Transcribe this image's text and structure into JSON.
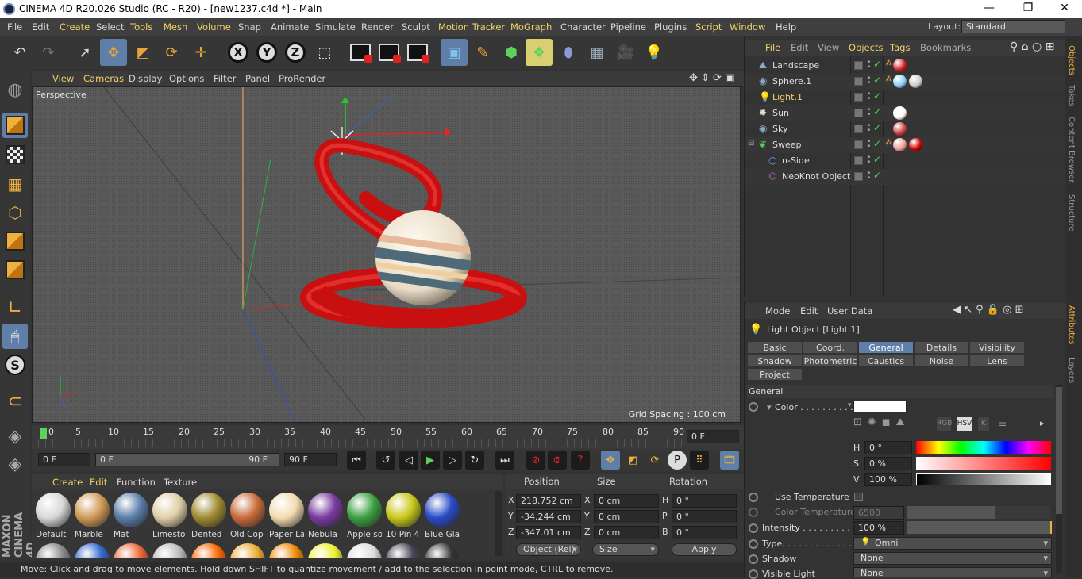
{
  "window": {
    "title": "CINEMA 4D R20.026 Studio (RC - R20) - [new1237.c4d *] - Main",
    "buttons": [
      "—",
      "❐",
      "✕"
    ]
  },
  "menubar": {
    "items": [
      "File",
      "Edit",
      "Create",
      "Select",
      "Tools",
      "Mesh",
      "Volume",
      "Snap",
      "Animate",
      "Simulate",
      "Render",
      "Sculpt",
      "Motion Tracker",
      "MoGraph",
      "Character",
      "Pipeline",
      "Plugins",
      "Script",
      "Window",
      "Help"
    ],
    "highlighted": [
      "Create",
      "Tools",
      "Mesh",
      "Volume",
      "Motion Tracker",
      "MoGraph",
      "Script",
      "Window"
    ],
    "layout_label": "Layout:",
    "layout_value": "Standard"
  },
  "viewport": {
    "menu": [
      "View",
      "Cameras",
      "Display",
      "Options",
      "Filter",
      "Panel",
      "ProRender"
    ],
    "label": "Perspective",
    "grid_spacing": "Grid Spacing : 100 cm"
  },
  "timeline": {
    "ticks": [
      "0",
      "5",
      "10",
      "15",
      "20",
      "25",
      "30",
      "35",
      "40",
      "45",
      "50",
      "55",
      "60",
      "65",
      "70",
      "75",
      "80",
      "85",
      "90"
    ],
    "frame": "0 F"
  },
  "transport": {
    "start": "0 F",
    "range_start": "0 F",
    "range_end": "90 F",
    "end": "90 F"
  },
  "materials": {
    "menu": [
      "Create",
      "Edit",
      "Function",
      "Texture"
    ],
    "items": [
      {
        "name": "Default",
        "color": "#d8d8d8"
      },
      {
        "name": "Marble",
        "color": "#d09a58"
      },
      {
        "name": "Mat",
        "color": "#5a7ea8"
      },
      {
        "name": "Limesto",
        "color": "#e0d0a8"
      },
      {
        "name": "Dented",
        "color": "#a08a30"
      },
      {
        "name": "Old Cop",
        "color": "#c86a38"
      },
      {
        "name": "Paper La",
        "color": "#f2dcb0"
      },
      {
        "name": "Nebula",
        "color": "#7a3aa0"
      },
      {
        "name": "Apple so",
        "color": "#3aa040"
      },
      {
        "name": "10 Pin 4",
        "color": "#c8c81a"
      },
      {
        "name": "Blue Gla",
        "color": "#2a4ac8"
      }
    ]
  },
  "coords": {
    "headers": [
      "Position",
      "Size",
      "Rotation"
    ],
    "rows": [
      {
        "axis": "X",
        "pos": "218.752 cm",
        "size_axis": "X",
        "size": "0 cm",
        "rot_axis": "H",
        "rot": "0 °"
      },
      {
        "axis": "Y",
        "pos": "-34.244 cm",
        "size_axis": "Y",
        "size": "0 cm",
        "rot_axis": "P",
        "rot": "0 °"
      },
      {
        "axis": "Z",
        "pos": "-347.01 cm",
        "size_axis": "Z",
        "size": "0 cm",
        "rot_axis": "B",
        "rot": "0 °"
      }
    ],
    "mode": "Object (Rel)",
    "size_mode": "Size",
    "apply": "Apply"
  },
  "status": "Move: Click and drag to move elements. Hold down SHIFT to quantize movement / add to the selection in point mode, CTRL to remove.",
  "objects": {
    "menu": [
      "File",
      "Edit",
      "View",
      "Objects",
      "Tags",
      "Bookmarks"
    ],
    "menu_highlight": [
      "File",
      "Objects",
      "Tags"
    ],
    "items": [
      {
        "name": "Landscape",
        "active": false
      },
      {
        "name": "Sphere.1",
        "active": false
      },
      {
        "name": "Light.1",
        "active": true
      },
      {
        "name": "Sun",
        "active": false
      },
      {
        "name": "Sky",
        "active": false
      },
      {
        "name": "Sweep",
        "active": false
      },
      {
        "name": "n-Side",
        "active": false
      },
      {
        "name": "NeoKnot Object",
        "active": false
      }
    ]
  },
  "right_tabs": [
    "Objects",
    "Takes",
    "Content Browser",
    "Structure",
    "Attributes",
    "Layers"
  ],
  "attributes": {
    "menu": [
      "Mode",
      "Edit",
      "User Data"
    ],
    "object_title": "Light Object [Light.1]",
    "tabs_row1": [
      "Basic",
      "Coord.",
      "General",
      "Details",
      "Visibility"
    ],
    "tabs_row2": [
      "Shadow",
      "Photometric",
      "Caustics",
      "Noise",
      "Lens"
    ],
    "tabs_row3": [
      "Project"
    ],
    "active_tab": "General",
    "section": "General",
    "color_label": "Color . . . . . . . . . .",
    "h_label": "H",
    "h_value": "0 °",
    "s_label": "S",
    "s_value": "0 %",
    "v_label": "V",
    "v_value": "100 %",
    "use_temp": "Use Temperature",
    "color_temp_label": "Color Temperature",
    "color_temp": "6500",
    "intensity_label": "Intensity . . . . . . . . . .",
    "intensity": "100 %",
    "type_label": "Type. . . . . . . . . . . . . .",
    "type": "Omni",
    "shadow_label": "Shadow",
    "shadow": "None",
    "visible_label": "Visible Light",
    "visible": "None",
    "color_swatch": "#ffffff",
    "colormodes": [
      "RGB",
      "HSV",
      "K"
    ]
  }
}
